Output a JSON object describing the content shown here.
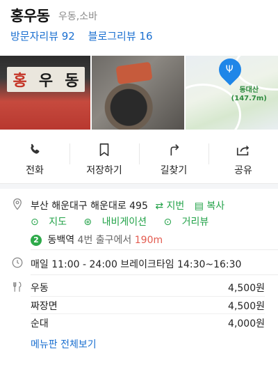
{
  "place": {
    "name": "홍우동",
    "category": "우동,소바",
    "visitor_reviews": "방문자리뷰 92",
    "blog_reviews": "블로그리뷰 16"
  },
  "photos": {
    "sign_chars": [
      "홍",
      "우",
      "동"
    ],
    "map_label_name": "동대산",
    "map_label_distance": "(147.7m)"
  },
  "actions": [
    {
      "label": "전화",
      "icon": "phone-icon"
    },
    {
      "label": "저장하기",
      "icon": "bookmark-icon"
    },
    {
      "label": "길찾기",
      "icon": "directions-icon"
    },
    {
      "label": "공유",
      "icon": "share-icon"
    }
  ],
  "address": {
    "text": "부산 해운대구 해운대로 495",
    "jibun": "⇄ 지번",
    "copy": "복사",
    "map": "지도",
    "navigation": "내비게이션",
    "street_view": "거리뷰"
  },
  "subway": {
    "line": "2",
    "station": "동백역",
    "exit": "4번 출구에서",
    "distance": "190m"
  },
  "hours": "매일 11:00 - 24:00 브레이크타임 14:30~16:30",
  "menu": {
    "items": [
      {
        "name": "우동",
        "price": "4,500원"
      },
      {
        "name": "짜장면",
        "price": "4,500원"
      },
      {
        "name": "순대",
        "price": "4,000원"
      }
    ],
    "more": "메뉴판 전체보기"
  },
  "colors": {
    "link_blue": "#1a6fd0",
    "green": "#22a248",
    "distance_red": "#e35b4f",
    "line2_green": "#2eaa4a"
  }
}
